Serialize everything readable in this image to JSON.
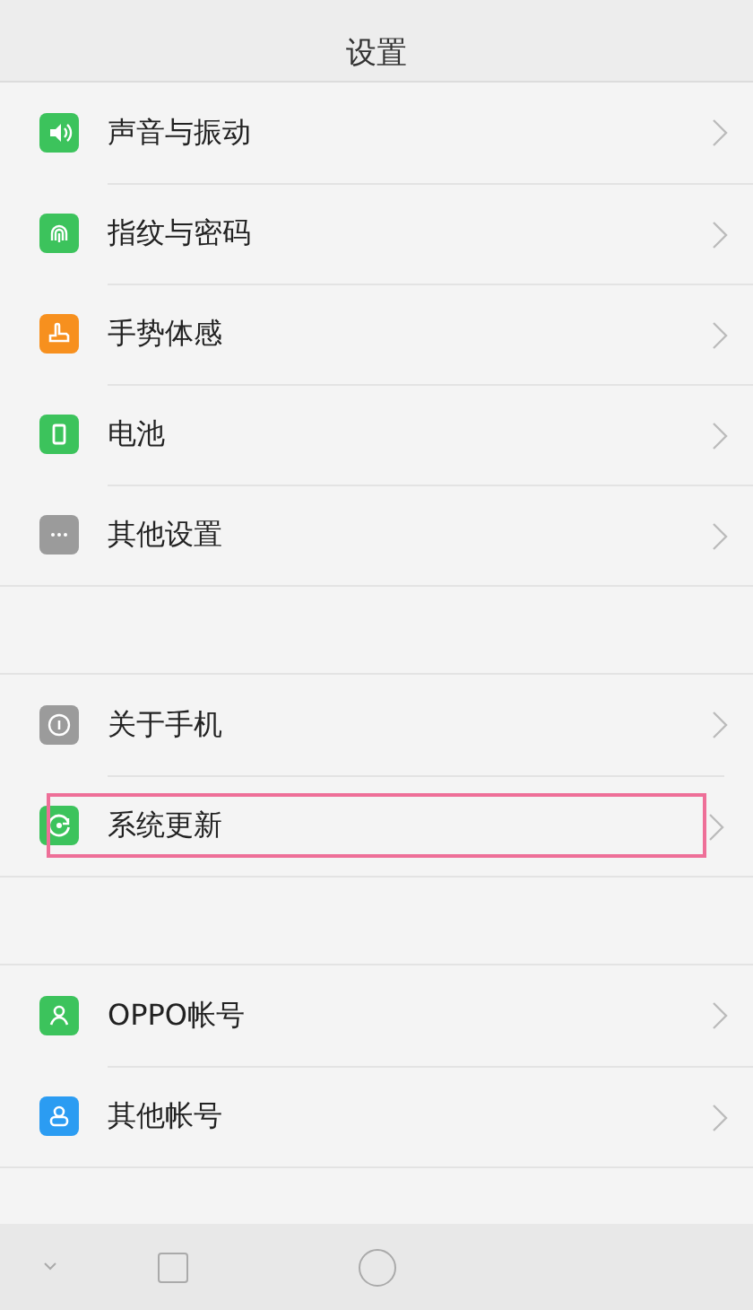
{
  "title": "设置",
  "groups": [
    {
      "items": [
        {
          "label": "声音与振动",
          "color": "#3cc35c",
          "highlighted": false
        },
        {
          "label": "指纹与密码",
          "color": "#3cc35c",
          "highlighted": false
        },
        {
          "label": "手势体感",
          "color": "#f7901e",
          "highlighted": false
        },
        {
          "label": "电池",
          "color": "#3cc35c",
          "highlighted": false
        },
        {
          "label": "其他设置",
          "color": "#9b9b9b",
          "highlighted": false
        }
      ]
    },
    {
      "items": [
        {
          "label": "关于手机",
          "color": "#9b9b9b",
          "highlighted": false
        },
        {
          "label": "系统更新",
          "color": "#3cc35c",
          "highlighted": true
        }
      ]
    },
    {
      "items": [
        {
          "label": "OPPO帐号",
          "color": "#3cc35c",
          "highlighted": false
        },
        {
          "label": "其他帐号",
          "color": "#2b9cf2",
          "highlighted": false
        }
      ]
    }
  ]
}
